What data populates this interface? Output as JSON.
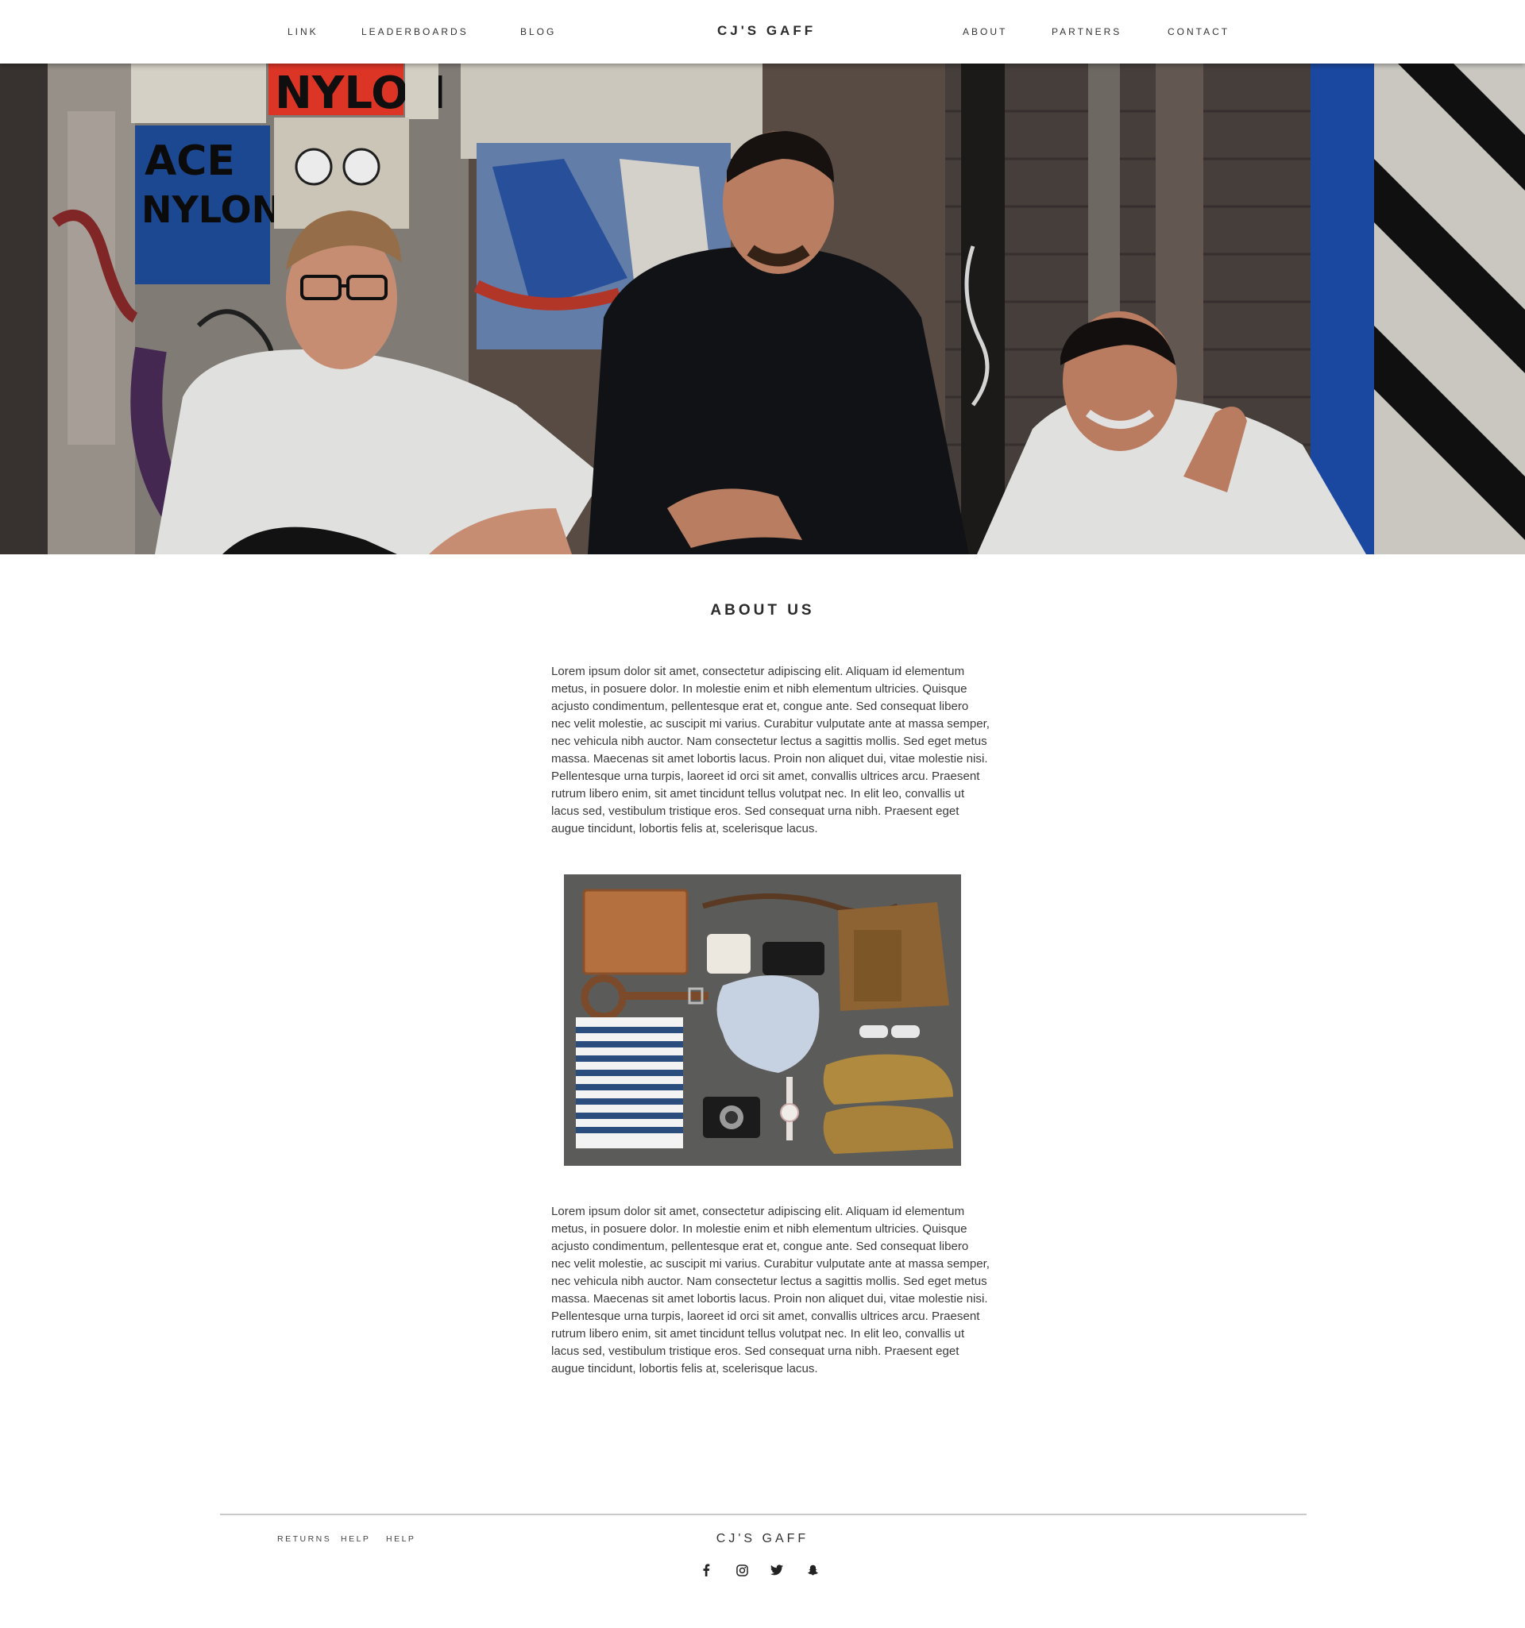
{
  "nav": {
    "left_links": [
      "LINK",
      "LEADERBOARDS",
      "BLOG"
    ],
    "brand": "CJ'S GAFF",
    "right_links": [
      "ABOUT",
      "PARTNERS",
      "CONTACT"
    ]
  },
  "hero": {
    "poster_text": [
      "NYLON",
      "ACE",
      "NYLON"
    ]
  },
  "main": {
    "title": "ABOUT US",
    "paragraph1": "Lorem ipsum dolor sit amet, consectetur adipiscing elit. Aliquam id elementum metus, in posuere dolor. In molestie enim et nibh elementum ultricies. Quisque acjusto condimentum, pellentesque erat et, congue ante. Sed consequat libero nec velit molestie, ac suscipit mi varius. Curabitur vulputate ante at massa semper, nec vehicula nibh auctor. Nam consectetur lectus a sagittis mollis. Sed eget metus massa. Maecenas sit amet lobortis lacus. Proin non aliquet dui, vitae molestie nisi. Pellentesque urna turpis, laoreet id orci sit amet, convallis ultrices arcu. Praesent rutrum libero enim, sit amet tincidunt tellus volutpat nec. In elit leo, convallis ut lacus sed, vestibulum tristique eros. Sed consequat urna nibh. Praesent eget augue tincidunt, lobortis felis at, scelerisque lacus.",
    "paragraph2": "Lorem ipsum dolor sit amet, consectetur adipiscing elit. Aliquam id elementum metus, in posuere dolor. In molestie enim et nibh elementum ultricies. Quisque acjusto condimentum, pellentesque erat et, congue ante. Sed consequat libero nec velit molestie, ac suscipit mi varius. Curabitur vulputate ante at massa semper, nec vehicula nibh auctor. Nam consectetur lectus a sagittis mollis. Sed eget metus massa. Maecenas sit amet lobortis lacus. Proin non aliquet dui, vitae molestie nisi. Pellentesque urna turpis, laoreet id orci sit amet, convallis ultrices arcu. Praesent rutrum libero enim, sit amet tincidunt tellus volutpat nec. In elit leo, convallis ut lacus sed, vestibulum tristique eros. Sed consequat urna nibh. Praesent eget augue tincidunt, lobortis felis at, scelerisque lacus."
  },
  "footer": {
    "links": [
      "RETURNS",
      "HELP",
      "HELP"
    ],
    "brand": "CJ'S GAFF",
    "social_icons": [
      "facebook-icon",
      "instagram-icon",
      "twitter-icon",
      "snapchat-icon"
    ]
  }
}
